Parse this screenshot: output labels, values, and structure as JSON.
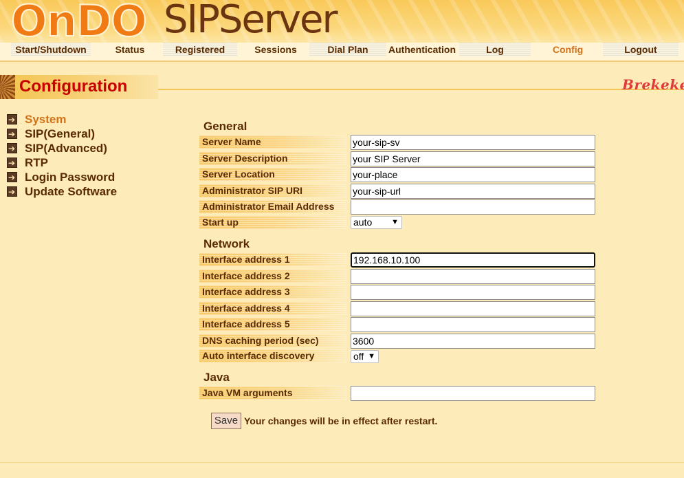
{
  "header": {
    "logo_ondo": "OnDO",
    "logo_product": "SIPServer"
  },
  "nav": {
    "items": [
      {
        "label": "Start/Shutdown"
      },
      {
        "label": "Status"
      },
      {
        "label": "Registered"
      },
      {
        "label": "Sessions"
      },
      {
        "label": "Dial Plan"
      },
      {
        "label": "Authentication"
      },
      {
        "label": "Log"
      },
      {
        "label": "Config",
        "active": true
      },
      {
        "label": "Logout"
      }
    ]
  },
  "page_title": "Configuration",
  "brand": "Brekeke",
  "sidebar": {
    "items": [
      {
        "label": "System",
        "active": true
      },
      {
        "label": "SIP(General)"
      },
      {
        "label": "SIP(Advanced)"
      },
      {
        "label": "RTP"
      },
      {
        "label": "Login Password"
      },
      {
        "label": "Update Software"
      }
    ]
  },
  "form": {
    "general": {
      "heading": "General",
      "server_name": {
        "label": "Server Name",
        "value": "your-sip-sv"
      },
      "server_description": {
        "label": "Server Description",
        "value": "your SIP Server"
      },
      "server_location": {
        "label": "Server Location",
        "value": "your-place"
      },
      "admin_sip_uri": {
        "label": "Administrator SIP URI",
        "value": "your-sip-url"
      },
      "admin_email": {
        "label": "Administrator Email Address",
        "value": ""
      },
      "start_up": {
        "label": "Start up",
        "value": "auto"
      }
    },
    "network": {
      "heading": "Network",
      "interface_1": {
        "label": "Interface address 1",
        "value": "192.168.10.100"
      },
      "interface_2": {
        "label": "Interface address 2",
        "value": ""
      },
      "interface_3": {
        "label": "Interface address 3",
        "value": ""
      },
      "interface_4": {
        "label": "Interface address 4",
        "value": ""
      },
      "interface_5": {
        "label": "Interface address 5",
        "value": ""
      },
      "dns_caching": {
        "label": "DNS caching period (sec)",
        "value": "3600"
      },
      "auto_discovery": {
        "label": "Auto interface discovery",
        "value": "off"
      }
    },
    "java": {
      "heading": "Java",
      "vm_args": {
        "label": "Java VM arguments",
        "value": ""
      }
    },
    "save_label": "Save",
    "note": "Your changes will be in effect after restart."
  },
  "colors": {
    "title_red": "#c80000",
    "active_orange": "#d4721a",
    "text_brown": "#5a2a00",
    "background": "#fdebb9"
  }
}
